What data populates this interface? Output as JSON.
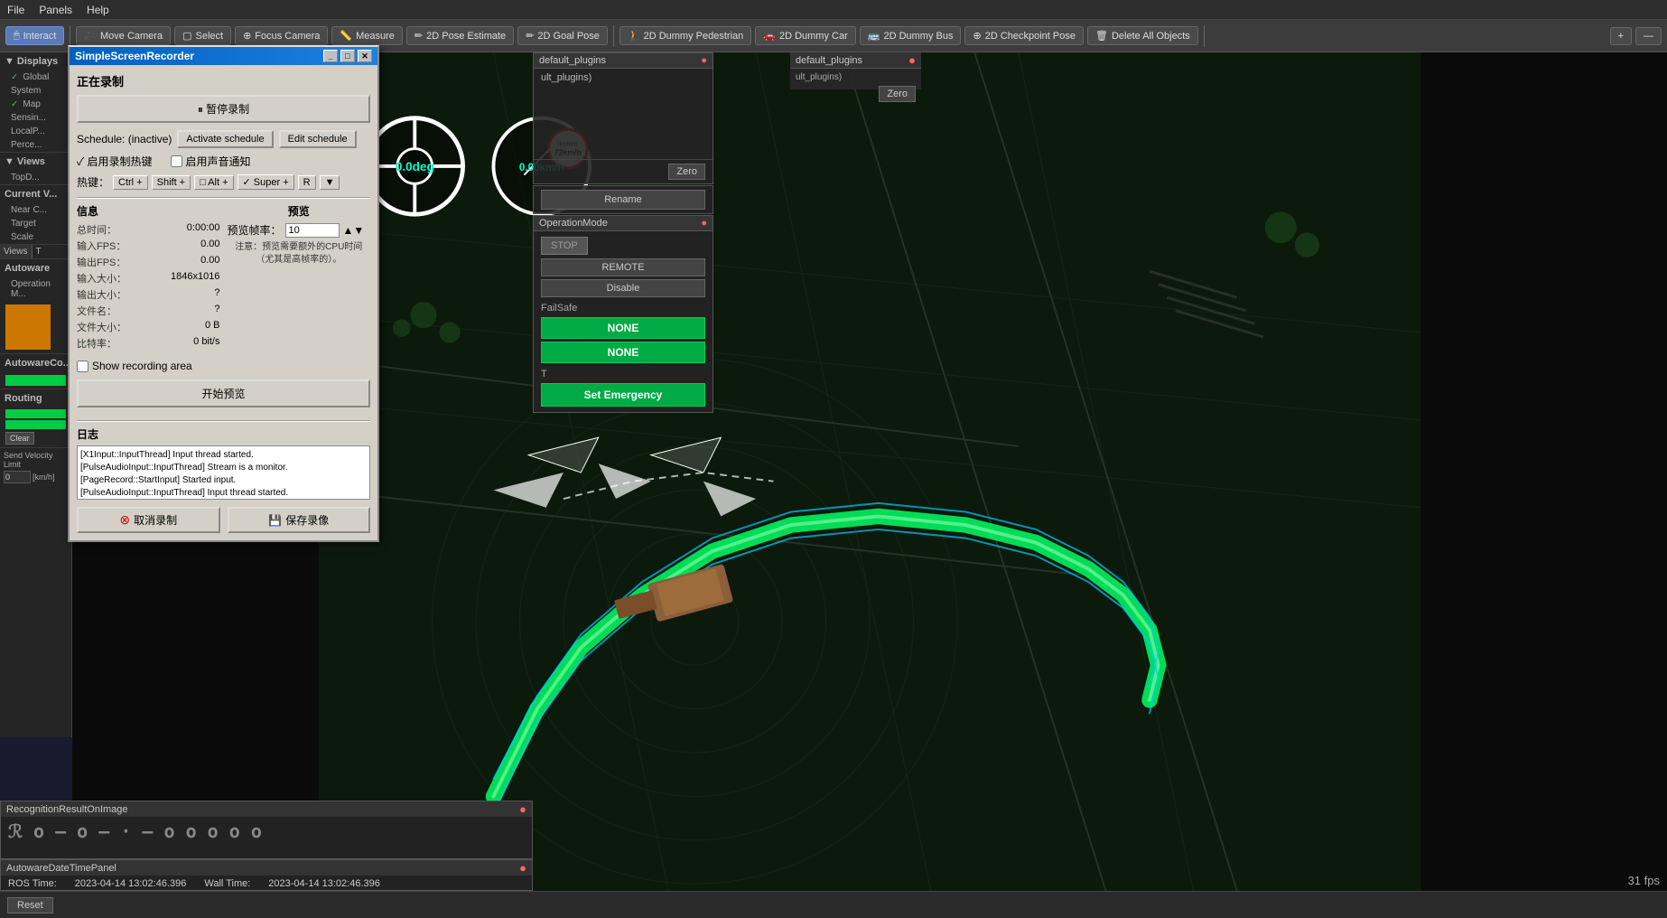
{
  "menubar": {
    "items": [
      "File",
      "Panels",
      "Help"
    ]
  },
  "toolbar": {
    "buttons": [
      {
        "label": "Interact",
        "icon": "cursor-icon",
        "active": true
      },
      {
        "label": "Move Camera",
        "icon": "move-camera-icon"
      },
      {
        "label": "Select",
        "icon": "select-icon"
      },
      {
        "label": "Focus Camera",
        "icon": "focus-camera-icon"
      },
      {
        "label": "Measure",
        "icon": "measure-icon"
      },
      {
        "label": "2D Pose Estimate",
        "icon": "pose-estimate-icon"
      },
      {
        "label": "2D Goal Pose",
        "icon": "goal-pose-icon"
      },
      {
        "label": "2D Dummy Pedestrian",
        "icon": "dummy-ped-icon"
      },
      {
        "label": "2D Dummy Car",
        "icon": "dummy-car-icon"
      },
      {
        "label": "2D Dummy Bus",
        "icon": "dummy-bus-icon"
      },
      {
        "label": "2D Checkpoint Pose",
        "icon": "checkpoint-icon"
      },
      {
        "label": "Delete All Objects",
        "icon": "delete-all-icon"
      }
    ]
  },
  "sidebar": {
    "sections": [
      {
        "title": "Displays",
        "icon": "displays-icon",
        "items": [
          {
            "label": "Global",
            "checked": true
          },
          {
            "label": "System",
            "checked": false
          },
          {
            "label": "Map",
            "checked": true
          },
          {
            "label": "Sensin...",
            "checked": false
          },
          {
            "label": "LocalP...",
            "checked": false
          },
          {
            "label": "Perce...",
            "checked": false
          }
        ]
      },
      {
        "title": "Views",
        "icon": "views-icon",
        "items": [
          {
            "label": "TopD...",
            "checked": false
          }
        ]
      },
      {
        "title": "Current V...",
        "items": [
          {
            "label": "Near C...",
            "checked": false
          },
          {
            "label": "Target",
            "checked": false
          },
          {
            "label": "Scale",
            "checked": false
          }
        ]
      },
      {
        "title": "Autoware",
        "items": [
          {
            "label": "Operation M...",
            "checked": false
          }
        ]
      },
      {
        "title": "AutowareCo...",
        "items": []
      },
      {
        "title": "Routing",
        "items": []
      }
    ]
  },
  "ssr_dialog": {
    "title": "SimpleScreenRecorder",
    "status": "正在录制",
    "pause_btn": "⏸ 暂停录制",
    "schedule_label": "Schedule: (inactive)",
    "activate_schedule_btn": "Activate schedule",
    "edit_schedule_btn": "Edit schedule",
    "enable_recording_hotkey": "✓ 启用录制热键",
    "enable_sound_notify": "启用声音通知",
    "hotkey_label": "热键：",
    "hotkey_parts": [
      "Ctrl +",
      "Shift +",
      "□ Alt +",
      "✓ Super +",
      "R",
      "▼"
    ],
    "info": {
      "title": "信息",
      "rows": [
        {
          "label": "总时间：",
          "value": "0:00:00"
        },
        {
          "label": "输入FPS：",
          "value": "0.00"
        },
        {
          "label": "输出FPS：",
          "value": "0.00"
        },
        {
          "label": "输入大小：",
          "value": "1846x1016"
        },
        {
          "label": "输出大小：",
          "value": "?"
        },
        {
          "label": "文件名：",
          "value": "?"
        },
        {
          "label": "文件大小：",
          "value": "0 B"
        },
        {
          "label": "比特率：",
          "value": "0 bit/s"
        }
      ]
    },
    "preview": {
      "title": "预览",
      "fps_label": "预览帧率：",
      "fps_value": "10",
      "note": "注意：预览需要额外的CPU时间（尤其是高帧率的）。"
    },
    "show_recording_area": "Show recording area",
    "start_preview_btn": "开始预览",
    "log": {
      "title": "日志",
      "entries": [
        "[X1Input::InputThread] Input thread started.",
        "[PulseAudioInput::InputThread] Stream is a monitor.",
        "[PageRecord::StartInput] Started input.",
        "[PulseAudioInput::InputThread] Input thread started."
      ]
    },
    "cancel_btn": "取消录制",
    "save_btn": "💾 保存录像"
  },
  "hud": {
    "steering_angle": "0.0deg",
    "speed": "0.00km/h",
    "speed_limit_label": "limited",
    "speed_limit_value": "72km/h"
  },
  "overlay_controls": {
    "sections": [
      {
        "id": "plugin-section",
        "title": "default_plugins",
        "items": [
          {
            "type": "text",
            "value": "ult_plugins)"
          }
        ],
        "buttons": [
          {
            "label": "Zero",
            "id": "zero-btn"
          },
          {
            "label": "Rename",
            "id": "rename-btn"
          }
        ]
      },
      {
        "id": "operation-section",
        "title": "OperationMode",
        "buttons": [
          {
            "label": "STOP",
            "id": "stop-btn",
            "disabled": true
          },
          {
            "label": "REMOTE",
            "id": "remote-btn"
          },
          {
            "label": "Disable",
            "id": "disable-btn"
          },
          {
            "label": "FailSafe",
            "id": "failsafe-label"
          },
          {
            "label": "NONE",
            "id": "none-btn-1",
            "style": "green"
          },
          {
            "label": "NONE",
            "id": "none-btn-2",
            "style": "green"
          },
          {
            "label": "T",
            "id": "t-btn"
          },
          {
            "label": "Set Emergency",
            "id": "emergency-btn",
            "style": "green"
          }
        ]
      },
      {
        "id": "routing-section",
        "title": "Routing",
        "buttons": [
          {
            "label": "Clear",
            "id": "clear-btn"
          }
        ]
      }
    ],
    "velocity_label": "Send Velocity Limit",
    "velocity_value": "0",
    "velocity_unit": "[km/h]"
  },
  "recognition_panel": {
    "title": "RecognitionResultOnImage",
    "waypoint_chars": [
      "R",
      "o",
      "—",
      "o",
      "—",
      "·",
      "—",
      "o",
      "o",
      "o",
      "o",
      "o"
    ]
  },
  "datetime_panel": {
    "title": "AutowareDateTimePanel",
    "ros_time_label": "ROS Time:",
    "ros_time_value": "2023-04-14 13:02:46.396",
    "wall_time_label": "Wall Time:",
    "wall_time_value": "2023-04-14 13:02:46.396"
  },
  "status_bar": {
    "reset_btn": "Reset",
    "fps": "31 fps"
  }
}
